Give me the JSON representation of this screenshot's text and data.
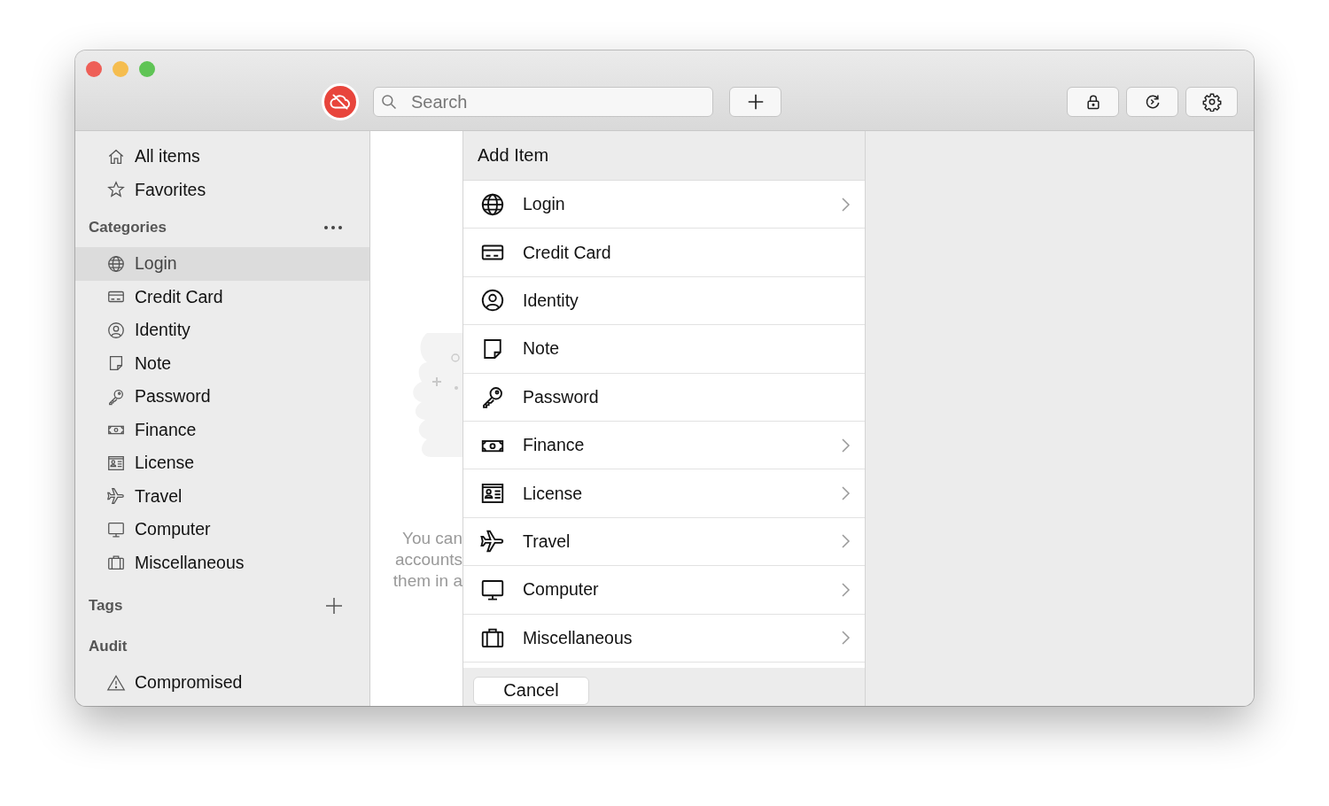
{
  "toolbar": {
    "search": {
      "placeholder": "Search"
    }
  },
  "sidebar": {
    "top_items": [
      {
        "label": "All items",
        "selected": false
      },
      {
        "label": "Favorites",
        "selected": false
      }
    ],
    "categories": {
      "title": "Categories",
      "items": [
        {
          "label": "Login",
          "selected": true
        },
        {
          "label": "Credit Card",
          "selected": false
        },
        {
          "label": "Identity",
          "selected": false
        },
        {
          "label": "Note",
          "selected": false
        },
        {
          "label": "Password",
          "selected": false
        },
        {
          "label": "Finance",
          "selected": false
        },
        {
          "label": "License",
          "selected": false
        },
        {
          "label": "Travel",
          "selected": false
        },
        {
          "label": "Computer",
          "selected": false
        },
        {
          "label": "Miscellaneous",
          "selected": false
        }
      ]
    },
    "tags": {
      "title": "Tags"
    },
    "audit": {
      "title": "Audit",
      "items": [
        {
          "label": "Compromised",
          "selected": false
        }
      ]
    }
  },
  "empty_state": {
    "lines": [
      "You can",
      "accounts",
      "them in a"
    ]
  },
  "add_item_sheet": {
    "title": "Add Item",
    "items": [
      {
        "label": "Login",
        "has_submenu": true
      },
      {
        "label": "Credit Card",
        "has_submenu": false
      },
      {
        "label": "Identity",
        "has_submenu": false
      },
      {
        "label": "Note",
        "has_submenu": false
      },
      {
        "label": "Password",
        "has_submenu": false
      },
      {
        "label": "Finance",
        "has_submenu": true
      },
      {
        "label": "License",
        "has_submenu": true
      },
      {
        "label": "Travel",
        "has_submenu": true
      },
      {
        "label": "Computer",
        "has_submenu": true
      },
      {
        "label": "Miscellaneous",
        "has_submenu": true
      }
    ],
    "cancel_button": "Cancel"
  }
}
